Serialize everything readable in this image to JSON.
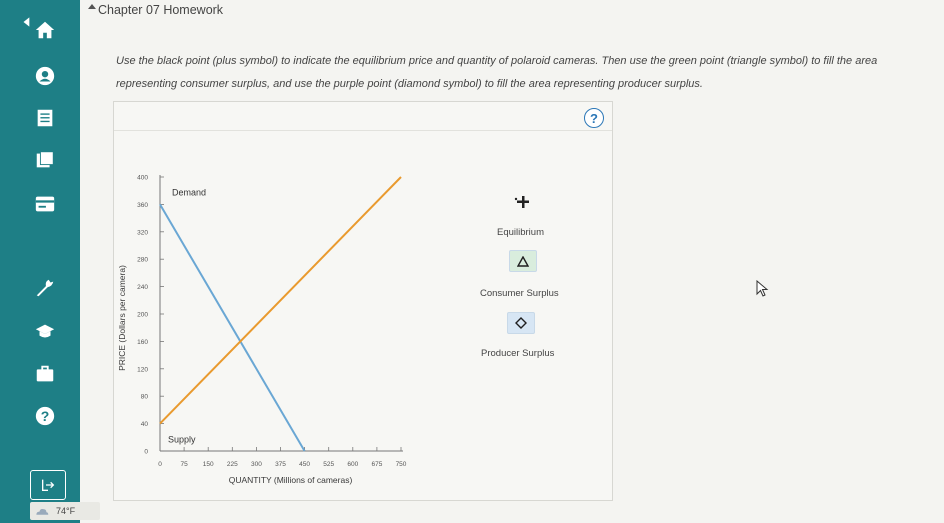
{
  "header": {
    "title": "Chapter 07 Homework"
  },
  "sidebar": {
    "items": [
      {
        "icon": "home-icon"
      },
      {
        "icon": "back-icon"
      },
      {
        "icon": "user-icon"
      },
      {
        "icon": "list-icon"
      },
      {
        "icon": "book-icon"
      },
      {
        "icon": "card-icon"
      },
      {
        "icon": "wrench-icon"
      },
      {
        "icon": "graduation-cap-icon"
      },
      {
        "icon": "briefcase-icon"
      },
      {
        "icon": "help-icon"
      }
    ],
    "help_glyph": "?"
  },
  "taskbar": {
    "temperature": "74°F"
  },
  "question": {
    "instructions": "Use the black point (plus symbol) to indicate the equilibrium price and quantity of polaroid cameras. Then use the green point (triangle symbol) to fill the area representing consumer surplus, and use the purple point (diamond symbol) to fill the area representing producer surplus.",
    "help_glyph": "?"
  },
  "tools": [
    {
      "label": "Equilibrium",
      "icon": "plus-icon",
      "color": "#222222"
    },
    {
      "label": "Consumer Surplus",
      "icon": "triangle-icon",
      "color": "#2e8b3e"
    },
    {
      "label": "Producer Surplus",
      "icon": "diamond-icon",
      "color": "#7a4fb5"
    }
  ],
  "chart_data": {
    "type": "line",
    "xlabel": "QUANTITY (Millions of cameras)",
    "ylabel": "PRICE (Dollars per camera)",
    "xlim": [
      0,
      750
    ],
    "ylim": [
      0,
      400
    ],
    "xticks": [
      0,
      75,
      150,
      225,
      300,
      375,
      450,
      525,
      600,
      675,
      750
    ],
    "yticks": [
      0,
      40,
      80,
      120,
      160,
      200,
      240,
      280,
      320,
      360,
      400
    ],
    "grid": false,
    "series": [
      {
        "name": "Demand",
        "color": "#6aa7d4",
        "points": [
          [
            0,
            360
          ],
          [
            450,
            0
          ]
        ]
      },
      {
        "name": "Supply",
        "color": "#e99a2e",
        "points": [
          [
            0,
            40
          ],
          [
            750,
            400
          ]
        ]
      }
    ]
  }
}
